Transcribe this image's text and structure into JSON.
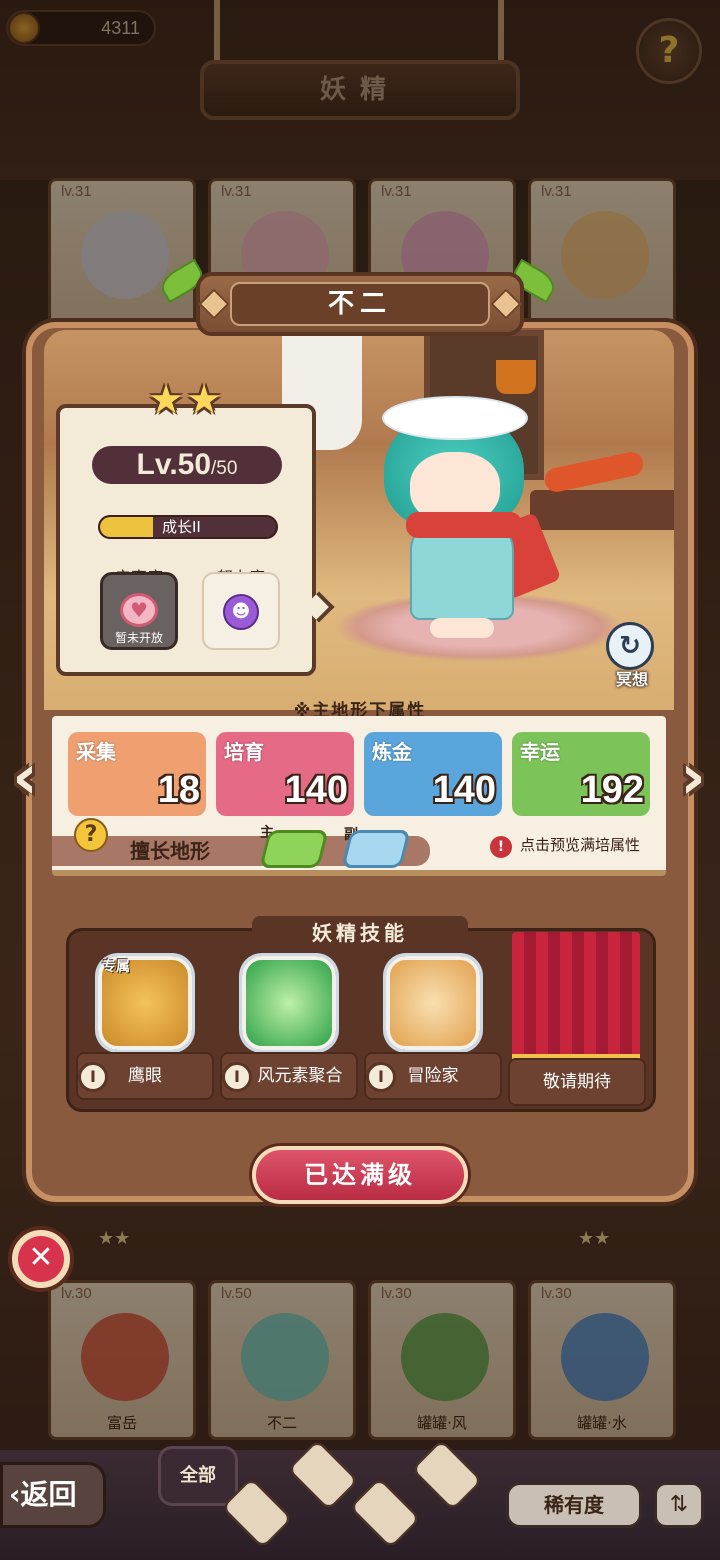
{
  "header": {
    "coins": "4311",
    "title": "妖精",
    "help_icon": "question-icon"
  },
  "roster_top": [
    {
      "level": "lv.31",
      "name": ""
    },
    {
      "level": "lv.31",
      "name": ""
    },
    {
      "level": "lv.31",
      "name": ""
    },
    {
      "level": "lv.31",
      "name": ""
    }
  ],
  "roster_bottom": [
    {
      "level": "lv.30",
      "name": "富岳"
    },
    {
      "level": "lv.50",
      "name": "不二"
    },
    {
      "level": "lv.30",
      "name": "罐罐·风"
    },
    {
      "level": "lv.30",
      "name": "罐罐·水"
    }
  ],
  "roster_stars": [
    "★★",
    "★★"
  ],
  "fairy": {
    "name": "不二",
    "stars": 2,
    "level": "Lv.50",
    "level_max": "/50",
    "growth_label": "成长II",
    "growth_fill": 0.3,
    "intimacy_label": "亲密度",
    "intimacy_status": "暂未开放",
    "effort_label": "努力度",
    "meditate_label": "冥想"
  },
  "attributes": {
    "title": "※主地形下属性",
    "items": [
      {
        "label": "采集",
        "value": "18",
        "color": "#f0a070"
      },
      {
        "label": "培育",
        "value": "140",
        "color": "#e46a86"
      },
      {
        "label": "炼金",
        "value": "140",
        "color": "#5aa6dc"
      },
      {
        "label": "幸运",
        "value": "192",
        "color": "#7cc45a"
      }
    ],
    "terrain_label": "擅长地形",
    "primary_label": "主",
    "secondary_label": "副",
    "preview_label": "点击预览满培属性"
  },
  "skills": {
    "title": "妖精技能",
    "exclusive_tag": "专属",
    "items": [
      {
        "name": "鹰眼",
        "badge": "I"
      },
      {
        "name": "风元素聚合",
        "badge": "I"
      },
      {
        "name": "冒险家",
        "badge": "I"
      },
      {
        "name": "敬请期待",
        "badge": ""
      }
    ]
  },
  "actions": {
    "max_level": "已达满级",
    "back": "返回",
    "all": "全部",
    "rarity": "稀有度"
  },
  "colors": {
    "accent": "#d8334d",
    "panel": "#8a5a3e"
  }
}
